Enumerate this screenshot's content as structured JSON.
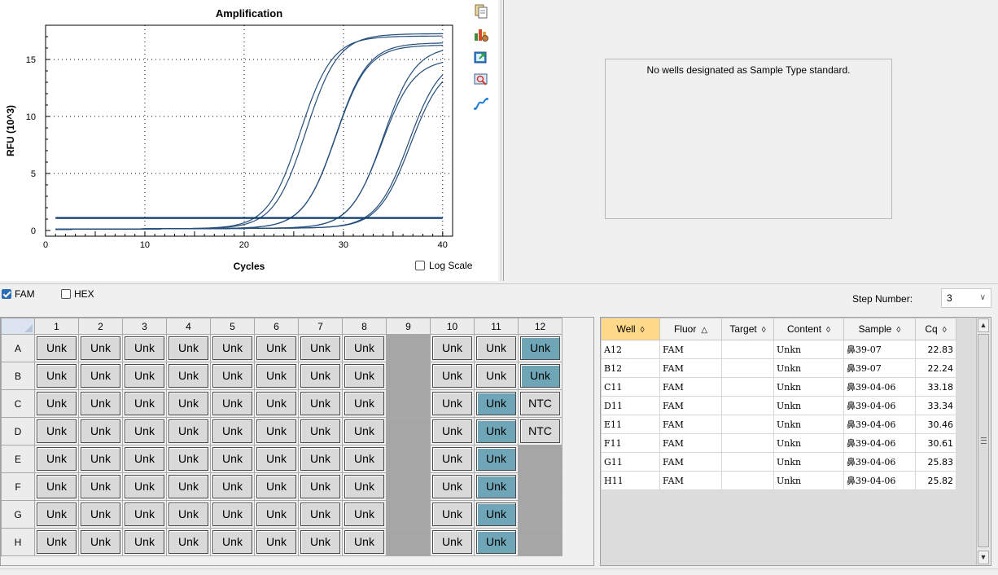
{
  "chart_data": {
    "type": "line",
    "title": "Amplification",
    "xlabel": "Cycles",
    "ylabel": "RFU (10^3)",
    "xlim": [
      0,
      41
    ],
    "ylim": [
      -0.5,
      18
    ],
    "xticks": [
      0,
      10,
      20,
      30,
      40
    ],
    "yticks": [
      0,
      5,
      10,
      15
    ],
    "grid": true,
    "log_scale": false,
    "threshold": 1.1,
    "series_color": "#244e7b",
    "series": [
      {
        "well": "A12",
        "cq": 22.83,
        "plateau": 17.0
      },
      {
        "well": "B12",
        "cq": 22.24,
        "plateau": 16.8
      },
      {
        "well": "C11",
        "cq": 33.18,
        "plateau": 15.0
      },
      {
        "well": "D11",
        "cq": 33.34,
        "plateau": 14.5
      },
      {
        "well": "E11",
        "cq": 30.46,
        "plateau": 14.8
      },
      {
        "well": "F11",
        "cq": 30.61,
        "plateau": 15.9
      },
      {
        "well": "G11",
        "cq": 25.83,
        "plateau": 16.2
      },
      {
        "well": "H11",
        "cq": 25.82,
        "plateau": 16.0
      }
    ]
  },
  "toolbar": {
    "icons": [
      "copy-icon",
      "chart-settings-icon",
      "export-icon",
      "zoom-icon",
      "curve-icon"
    ]
  },
  "log_scale_label": "Log Scale",
  "standard_curve": {
    "message": "No wells designated as Sample Type standard."
  },
  "fluors": [
    {
      "label": "FAM",
      "checked": true
    },
    {
      "label": "HEX",
      "checked": false
    }
  ],
  "step": {
    "label": "Step Number:",
    "value": "3"
  },
  "plate": {
    "columns": [
      "1",
      "2",
      "3",
      "4",
      "5",
      "6",
      "7",
      "8",
      "9",
      "10",
      "11",
      "12"
    ],
    "rows": [
      {
        "label": "A",
        "cells": [
          "Unk",
          "Unk",
          "Unk",
          "Unk",
          "Unk",
          "Unk",
          "Unk",
          "Unk",
          "",
          "Unk",
          "Unk",
          "Unk"
        ],
        "selected": [
          12
        ]
      },
      {
        "label": "B",
        "cells": [
          "Unk",
          "Unk",
          "Unk",
          "Unk",
          "Unk",
          "Unk",
          "Unk",
          "Unk",
          "",
          "Unk",
          "Unk",
          "Unk"
        ],
        "selected": [
          12
        ]
      },
      {
        "label": "C",
        "cells": [
          "Unk",
          "Unk",
          "Unk",
          "Unk",
          "Unk",
          "Unk",
          "Unk",
          "Unk",
          "",
          "Unk",
          "Unk",
          "NTC"
        ],
        "selected": [
          11
        ]
      },
      {
        "label": "D",
        "cells": [
          "Unk",
          "Unk",
          "Unk",
          "Unk",
          "Unk",
          "Unk",
          "Unk",
          "Unk",
          "",
          "Unk",
          "Unk",
          "NTC"
        ],
        "selected": [
          11
        ]
      },
      {
        "label": "E",
        "cells": [
          "Unk",
          "Unk",
          "Unk",
          "Unk",
          "Unk",
          "Unk",
          "Unk",
          "Unk",
          "",
          "Unk",
          "Unk",
          ""
        ],
        "selected": [
          11
        ]
      },
      {
        "label": "F",
        "cells": [
          "Unk",
          "Unk",
          "Unk",
          "Unk",
          "Unk",
          "Unk",
          "Unk",
          "Unk",
          "",
          "Unk",
          "Unk",
          ""
        ],
        "selected": [
          11
        ]
      },
      {
        "label": "G",
        "cells": [
          "Unk",
          "Unk",
          "Unk",
          "Unk",
          "Unk",
          "Unk",
          "Unk",
          "Unk",
          "",
          "Unk",
          "Unk",
          ""
        ],
        "selected": [
          11
        ]
      },
      {
        "label": "H",
        "cells": [
          "Unk",
          "Unk",
          "Unk",
          "Unk",
          "Unk",
          "Unk",
          "Unk",
          "Unk",
          "",
          "Unk",
          "Unk",
          ""
        ],
        "selected": [
          11
        ]
      }
    ]
  },
  "results": {
    "columns": [
      {
        "label": "Well",
        "sort": "◊",
        "sorted": true
      },
      {
        "label": "Fluor",
        "sort": "△",
        "sorted": false
      },
      {
        "label": "Target",
        "sort": "◊",
        "sorted": false
      },
      {
        "label": "Content",
        "sort": "◊",
        "sorted": false
      },
      {
        "label": "Sample",
        "sort": "◊",
        "sorted": false
      },
      {
        "label": "Cq",
        "sort": "◊",
        "sorted": false
      }
    ],
    "rows": [
      [
        "A12",
        "FAM",
        "",
        "Unkn",
        "鼻39-07",
        "22.83"
      ],
      [
        "B12",
        "FAM",
        "",
        "Unkn",
        "鼻39-07",
        "22.24"
      ],
      [
        "C11",
        "FAM",
        "",
        "Unkn",
        "鼻39-04-06",
        "33.18"
      ],
      [
        "D11",
        "FAM",
        "",
        "Unkn",
        "鼻39-04-06",
        "33.34"
      ],
      [
        "E11",
        "FAM",
        "",
        "Unkn",
        "鼻39-04-06",
        "30.46"
      ],
      [
        "F11",
        "FAM",
        "",
        "Unkn",
        "鼻39-04-06",
        "30.61"
      ],
      [
        "G11",
        "FAM",
        "",
        "Unkn",
        "鼻39-04-06",
        "25.83"
      ],
      [
        "H11",
        "FAM",
        "",
        "Unkn",
        "鼻39-04-06",
        "25.82"
      ]
    ]
  }
}
